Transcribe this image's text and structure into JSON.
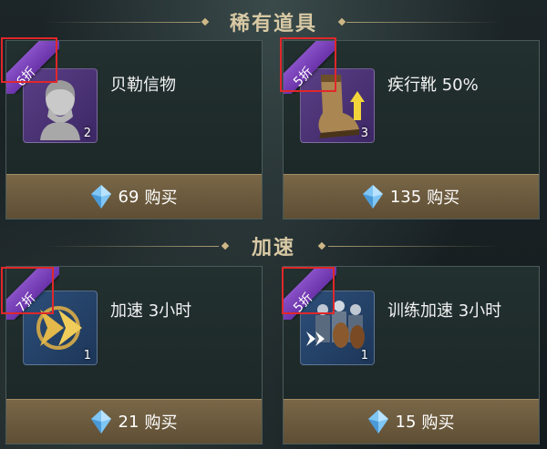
{
  "sections": [
    {
      "title": "稀有道具"
    },
    {
      "title": "加速"
    }
  ],
  "items": [
    {
      "name": "贝勒信物",
      "count": "2",
      "discount": "6折",
      "price": "69",
      "buy_label": "购买",
      "icon": "bust-statue-icon"
    },
    {
      "name": "疾行靴 50%",
      "count": "3",
      "discount": "5折",
      "price": "135",
      "buy_label": "购买",
      "icon": "boot-icon"
    },
    {
      "name": "加速 3小时",
      "count": "1",
      "discount": "7折",
      "price": "21",
      "buy_label": "购买",
      "icon": "speed-arrows-icon"
    },
    {
      "name": "训练加速 3小时",
      "count": "1",
      "discount": "5折",
      "price": "15",
      "buy_label": "购买",
      "icon": "soldiers-icon"
    }
  ],
  "colors": {
    "discount_ribbon": "#7a42b8",
    "buy_button": "#6e5c3e",
    "highlight_box": "#e0272a",
    "section_title": "#d8c9a4"
  }
}
